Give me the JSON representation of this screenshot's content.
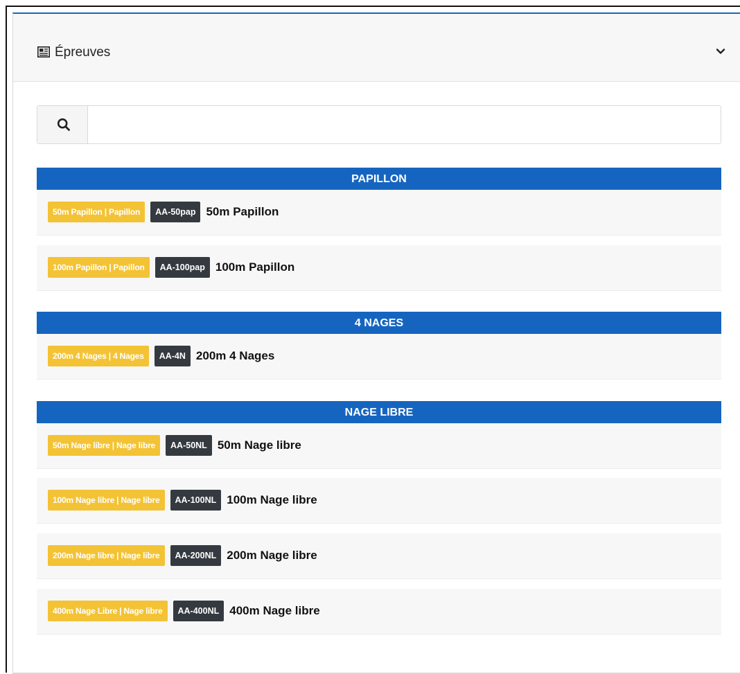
{
  "card": {
    "title": "Épreuves",
    "header_icon": "newspaper-icon",
    "collapse_icon": "chevron-down-icon",
    "accent_color": "#1565c0"
  },
  "search": {
    "icon": "search-icon",
    "value": "",
    "placeholder": ""
  },
  "groups": [
    {
      "title": "PAPILLON",
      "events": [
        {
          "category": "50m Papillon | Papillon",
          "code": "AA-50pap",
          "name": "50m Papillon"
        },
        {
          "category": "100m Papillon | Papillon",
          "code": "AA-100pap",
          "name": "100m Papillon"
        }
      ]
    },
    {
      "title": "4 NAGES",
      "events": [
        {
          "category": "200m 4 Nages | 4 Nages",
          "code": "AA-4N",
          "name": "200m 4 Nages"
        }
      ]
    },
    {
      "title": "NAGE LIBRE",
      "events": [
        {
          "category": "50m Nage libre | Nage libre",
          "code": "AA-50NL",
          "name": "50m Nage libre"
        },
        {
          "category": "100m Nage libre | Nage libre",
          "code": "AA-100NL",
          "name": "100m Nage libre"
        },
        {
          "category": "200m Nage libre | Nage libre",
          "code": "AA-200NL",
          "name": "200m Nage libre"
        },
        {
          "category": "400m Nage Libre | Nage libre",
          "code": "AA-400NL",
          "name": "400m Nage libre"
        }
      ]
    }
  ],
  "colors": {
    "group_header_bg": "#1565c0",
    "category_badge_bg": "#f3c335",
    "code_badge_bg": "#343a40",
    "row_bg": "#f7f7f7"
  }
}
